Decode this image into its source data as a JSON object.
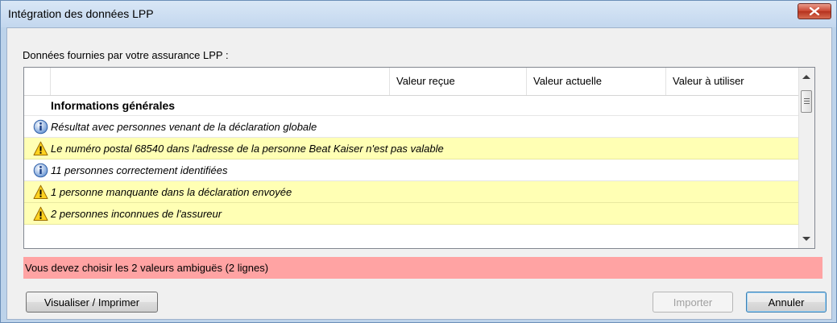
{
  "window": {
    "title": "Intégration des données LPP",
    "close_icon": "close-icon"
  },
  "section_label": "Données fournies par votre assurance LPP :",
  "grid": {
    "columns": [
      "Valeur reçue",
      "Valeur actuelle",
      "Valeur à utiliser"
    ],
    "rows": [
      {
        "type": "group",
        "icon": "",
        "text": "Informations générales"
      },
      {
        "type": "info",
        "icon": "info-icon",
        "text": "Résultat avec personnes venant de la déclaration globale"
      },
      {
        "type": "warning",
        "icon": "warning-icon",
        "text": "Le numéro postal 68540 dans l'adresse de la personne Beat Kaiser n'est pas valable"
      },
      {
        "type": "info",
        "icon": "info-icon",
        "text": "11 personnes correctement identifiées"
      },
      {
        "type": "warning",
        "icon": "warning-icon",
        "text": "1 personne manquante dans la déclaration envoyée"
      },
      {
        "type": "warning",
        "icon": "warning-icon",
        "text": "2 personnes inconnues de l'assureur"
      }
    ]
  },
  "status_message": "Vous devez choisir les 2 valeurs ambiguës (2 lignes)",
  "buttons": {
    "print": "Visualiser / Imprimer",
    "import": "Importer",
    "cancel": "Annuler"
  },
  "colors": {
    "warning_row": "#ffffb4",
    "status_error": "#ffa3a3",
    "title_bar": "#c3d7ee"
  }
}
